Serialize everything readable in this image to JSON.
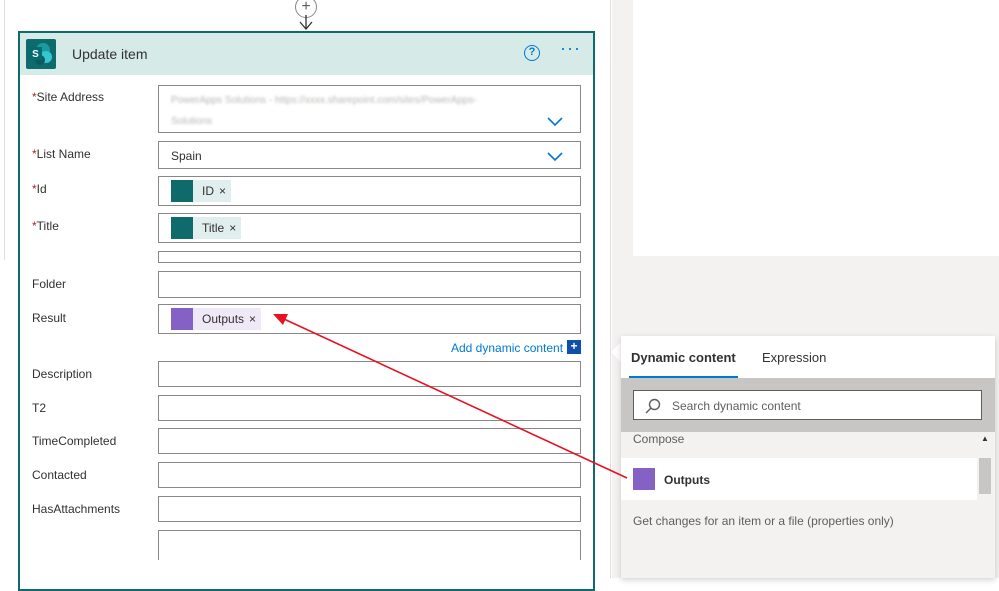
{
  "card": {
    "title": "Update item"
  },
  "fields": {
    "site_address": {
      "label": "Site Address",
      "blurred_line1": "PowerApps Solutions - https://xxxx.sharepoint.com/sites/PowerApps-",
      "blurred_line2": "Solutions"
    },
    "list_name": {
      "label": "List Name",
      "value": "Spain"
    },
    "id": {
      "label": "Id",
      "token": "ID"
    },
    "title": {
      "label": "Title",
      "token": "Title"
    },
    "folder": {
      "label": "Folder"
    },
    "result": {
      "label": "Result",
      "token": "Outputs"
    },
    "description": {
      "label": "Description"
    },
    "t2": {
      "label": "T2"
    },
    "time_completed": {
      "label": "TimeCompleted"
    },
    "contacted": {
      "label": "Contacted"
    },
    "has_attachments": {
      "label": "HasAttachments"
    }
  },
  "required_marker": "*",
  "token_remove": "×",
  "add_dynamic": {
    "label": "Add dynamic content",
    "icon": "+"
  },
  "dynamic_panel": {
    "tabs": [
      "Dynamic content",
      "Expression"
    ],
    "search_placeholder": "Search dynamic content",
    "sections": [
      {
        "label": "Compose",
        "items": [
          "Outputs"
        ]
      },
      {
        "label": "Get changes for an item or a file (properties only)"
      }
    ]
  },
  "colors": {
    "accent": "#0078d4",
    "sharepoint_teal": "#0f6b6b",
    "compose_purple": "#8661c5",
    "required_red": "#a4262c",
    "annotation_arrow": "#e81123"
  },
  "icons": {
    "insert": "plus-circle-icon",
    "help": "question-circle-icon",
    "more": "ellipsis-icon",
    "dropdown": "chevron-down-icon",
    "search": "search-icon",
    "app": "sharepoint-logo-icon"
  }
}
